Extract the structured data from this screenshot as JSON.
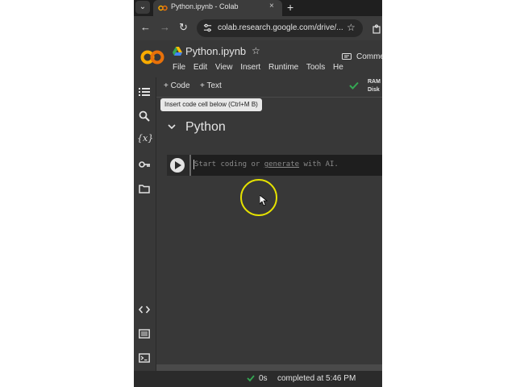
{
  "browser": {
    "tab_title": "Python.ipynb - Colab",
    "tab_close": "×",
    "new_tab": "+",
    "url": "colab.research.google.com/drive/...",
    "nav": {
      "back": "←",
      "forward": "→",
      "reload": "↻"
    },
    "bookmark_star": "☆"
  },
  "colab": {
    "logo": "CO",
    "notebook_title": "Python.ipynb",
    "title_star": "☆",
    "menu": [
      "File",
      "Edit",
      "View",
      "Insert",
      "Runtime",
      "Tools",
      "He"
    ],
    "comment_label": "Comme"
  },
  "toolbar": {
    "add_code": "+ Code",
    "add_text": "+ Text",
    "ram": "RAM",
    "disk": "Disk",
    "tooltip": "Insert code cell below (Ctrl+M B)"
  },
  "notebook": {
    "section_title": "Python",
    "cell_placeholder_start": "Start coding or ",
    "cell_placeholder_link": "generate",
    "cell_placeholder_end": " with AI."
  },
  "rail": {
    "icons": [
      "toc-icon",
      "search-icon",
      "variables-icon",
      "secrets-key-icon",
      "folder-icon",
      "code-snippets-icon",
      "command-palette-icon",
      "terminal-icon"
    ],
    "variables_glyph": "{x}"
  },
  "status": {
    "duration": "0s",
    "completed": "completed at 5:46 PM"
  },
  "colors": {
    "accent_orange": "#f9ab00",
    "cursor_highlight": "#e5e200",
    "success_green": "#34a853"
  }
}
